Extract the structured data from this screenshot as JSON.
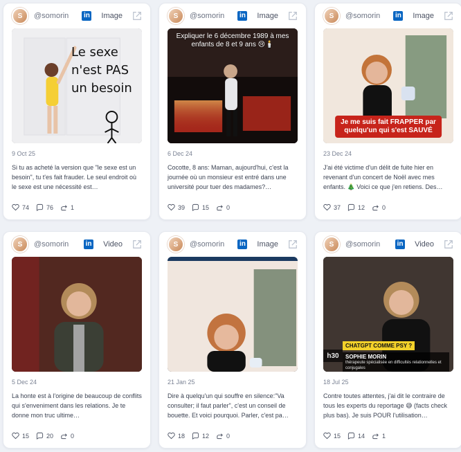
{
  "theme": {
    "accent_linkedin": "#0a66c2",
    "badge_red": "#c7241b"
  },
  "cards": [
    {
      "handle": "@somorin",
      "type": "Image",
      "date": "9 Oct 25",
      "caption": "Si tu as acheté la version que \"le sexe est un besoin\", tu t'es fait frauder. Le seul endroit où le sexe est une nécessité est…",
      "stats": {
        "likes": "74",
        "comments": "76",
        "shares": "1"
      },
      "media": {
        "overlay_lines": [
          "Le sexe",
          "n'est PAS",
          "un besoin"
        ]
      }
    },
    {
      "handle": "@somorin",
      "type": "Image",
      "date": "6 Dec 24",
      "caption": "Cocotte, 8 ans: Maman, aujourd'hui, c'est la journée où un monsieur est entré dans une université pour tuer des madames?…",
      "stats": {
        "likes": "39",
        "comments": "15",
        "shares": "0"
      },
      "media": {
        "top_text": "Expliquer le 6 décembre 1989 à mes enfants de 8 et 9 ans 😢🕯️"
      }
    },
    {
      "handle": "@somorin",
      "type": "Image",
      "date": "23 Dec 24",
      "caption": "J'ai été victime d'un délit de fuite hier en revenant d'un concert de Noël avec mes enfants. 🎄 Voici ce que j'en retiens. Des…",
      "stats": {
        "likes": "37",
        "comments": "12",
        "shares": "0"
      },
      "media": {
        "badge_lines": [
          "Je me suis fait FRAPPER par",
          "quelqu'un qui s'est SAUVÉ"
        ]
      }
    },
    {
      "handle": "@somorin",
      "type": "Video",
      "date": "5 Dec 24",
      "caption": "La honte est à l'origine de beaucoup de conflits qui s'enveniment dans les relations. Je te donne mon truc ultime…",
      "stats": {
        "likes": "15",
        "comments": "20",
        "shares": "0"
      },
      "media": {}
    },
    {
      "handle": "@somorin",
      "type": "Image",
      "date": "21 Jan 25",
      "caption": "Dire à quelqu'un qui souffre en silence:\"Va consulter; il faut parler\", c'est un conseil de bouette. Et voici pourquoi. Parler, c'est pa…",
      "stats": {
        "likes": "18",
        "comments": "12",
        "shares": "0"
      },
      "media": {}
    },
    {
      "handle": "@somorin",
      "type": "Video",
      "date": "18 Jul 25",
      "caption": "Contre toutes attentes, j'ai dit le contraire de tous les experts du reportage 😅 (facts check plus bas). Je suis POUR l'utilisation…",
      "stats": {
        "likes": "15",
        "comments": "14",
        "shares": "1"
      },
      "media": {
        "lower_third_title": "CHATGPT COMME PSY ?",
        "lower_third_name": "SOPHIE MORIN",
        "lower_third_subtitle": "thérapeute spécialisée en difficultés relationnelles et conjugales",
        "channel_mark": "h30"
      }
    }
  ]
}
